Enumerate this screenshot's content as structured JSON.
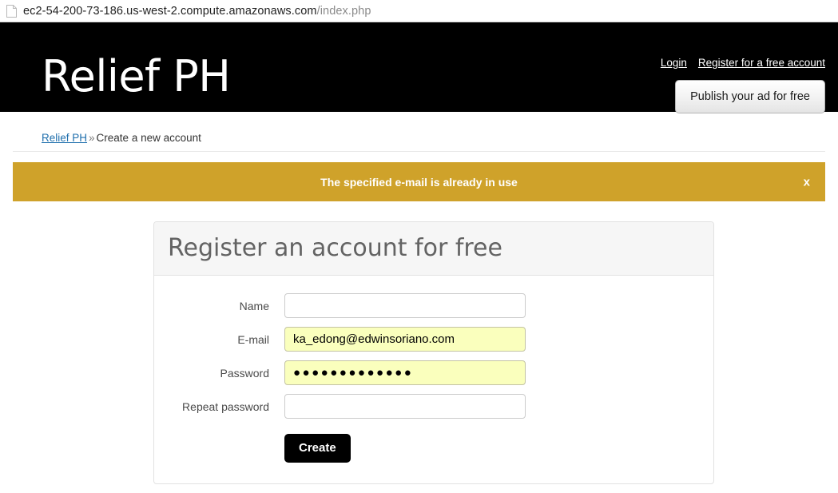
{
  "browser": {
    "url_host": "ec2-54-200-73-186.us-west-2.compute.amazonaws.com",
    "url_path": "/index.php",
    "doc_icon": "document-icon"
  },
  "header": {
    "logo": "Relief PH",
    "login_label": "Login",
    "register_label": "Register for a free account",
    "publish_label": "Publish your ad for free",
    "background": "#000000"
  },
  "breadcrumb": {
    "home_label": "Relief PH",
    "separator": "»",
    "current": "Create a new account"
  },
  "alert": {
    "message": "The specified e-mail is already in use",
    "close_label": "x",
    "background": "#cfa22a",
    "text_color": "#ffffff"
  },
  "panel": {
    "title": "Register an account for free",
    "fields": [
      {
        "label": "Name",
        "name": "name-field",
        "type": "text",
        "value": "",
        "placeholder": "",
        "autofilled": false
      },
      {
        "label": "E-mail",
        "name": "email-field",
        "type": "text",
        "value": "ka_edong@edwinsoriano.com",
        "placeholder": "",
        "autofilled": true
      },
      {
        "label": "Password",
        "name": "password-field",
        "type": "password",
        "value": "●●●●●●●●●●●●●",
        "placeholder": "",
        "autofilled": true
      },
      {
        "label": "Repeat password",
        "name": "repeat-password-field",
        "type": "password",
        "value": "",
        "placeholder": "",
        "autofilled": false
      }
    ],
    "submit_label": "Create"
  }
}
